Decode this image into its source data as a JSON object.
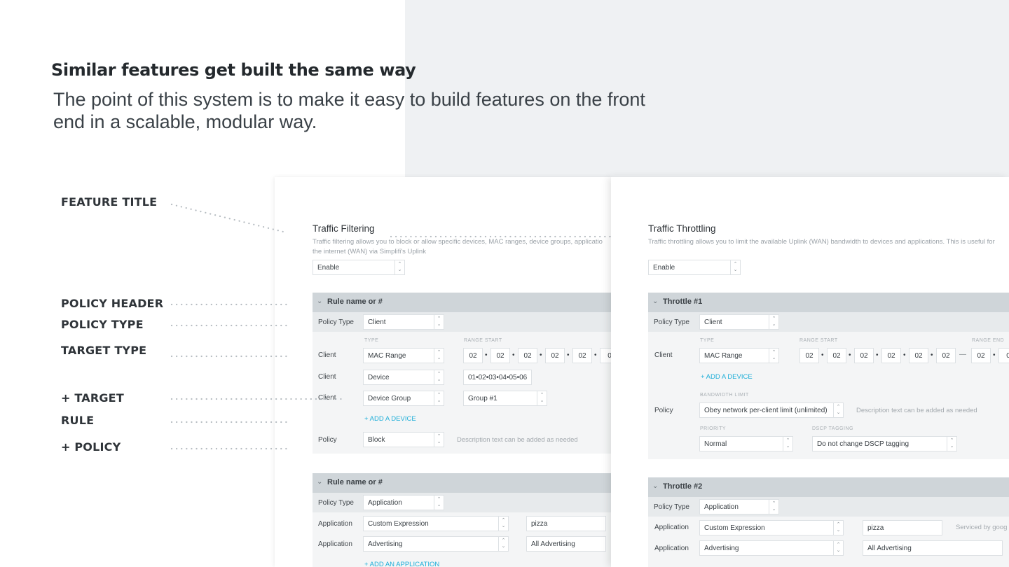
{
  "headline": "Similar features get built the same way",
  "subhead": "The point of this system is to make it easy to build features on the front end in a scalable, modular way.",
  "annotations": [
    "FEATURE TITLE",
    "POLICY HEADER",
    "POLICY TYPE",
    "TARGET TYPE",
    "+ TARGET",
    "RULE",
    "+ POLICY"
  ],
  "filtering": {
    "title": "Traffic Filtering",
    "desc1": "Traffic filtering allows you to block or allow specific devices, MAC ranges, device groups, applicatio",
    "desc2": "the internet (WAN) via Simplifi's Uplink",
    "enable": "Enable",
    "rule1": {
      "header": "Rule name or #",
      "policy_type_label": "Policy Type",
      "policy_type_value": "Client",
      "col_type": "TYPE",
      "col_range_start": "RANGE START",
      "rows": [
        {
          "label": "Client",
          "type": "MAC Range"
        },
        {
          "label": "Client",
          "type": "Device",
          "value": "01•02•03•04•05•06"
        },
        {
          "label": "Client",
          "type": "Device Group",
          "value": "Group #1"
        }
      ],
      "mac_segments": [
        "02",
        "02",
        "02",
        "02",
        "02",
        "0"
      ],
      "add_link": "+ ADD A DEVICE",
      "policy_label": "Policy",
      "policy_value": "Block",
      "policy_hint": "Description text can be added as needed"
    },
    "rule2": {
      "header": "Rule name or #",
      "policy_type_label": "Policy Type",
      "policy_type_value": "Application",
      "rows": [
        {
          "label": "Application",
          "type": "Custom Expression",
          "value": "pizza"
        },
        {
          "label": "Application",
          "type": "Advertising",
          "value": "All Advertising"
        }
      ],
      "add_link": "+ ADD AN APPLICATION"
    }
  },
  "throttling": {
    "title": "Traffic Throttling",
    "desc1": "Traffic throttling allows you to limit the available Uplink (WAN) bandwidth to devices and applications. This is useful for",
    "enable": "Enable",
    "rule1": {
      "header": "Throttle #1",
      "policy_type_label": "Policy Type",
      "policy_type_value": "Client",
      "col_type": "TYPE",
      "col_range_start": "RANGE START",
      "col_range_end": "RANGE END",
      "row_label": "Client",
      "row_type": "MAC Range",
      "mac_start": [
        "02",
        "02",
        "02",
        "02",
        "02",
        "02"
      ],
      "range_dash": "—",
      "mac_end": [
        "02",
        "0"
      ],
      "add_link": "+ ADD A DEVICE",
      "bw_label": "BANDWIDTH LIMIT",
      "policy_label": "Policy",
      "policy_value": "Obey network per-client limit (unlimited)",
      "policy_hint": "Description text can be added as needed",
      "priority_label": "PRIORITY",
      "priority_value": "Normal",
      "dscp_label": "DSCP TAGGING",
      "dscp_value": "Do not change DSCP tagging"
    },
    "rule2": {
      "header": "Throttle #2",
      "policy_type_label": "Policy Type",
      "policy_type_value": "Application",
      "rows": [
        {
          "label": "Application",
          "type": "Custom Expression",
          "value": "pizza",
          "hint": "Serviced by goog"
        },
        {
          "label": "Application",
          "type": "Advertising",
          "value": "All Advertising"
        }
      ]
    }
  },
  "icons": {
    "spinner": "spinner-arrows-icon",
    "chevron": "chevron-down-icon"
  },
  "colors": {
    "accent_link": "#1eaed8",
    "header_bar": "#cfd5d9",
    "background_gray": "#eff1f3"
  }
}
